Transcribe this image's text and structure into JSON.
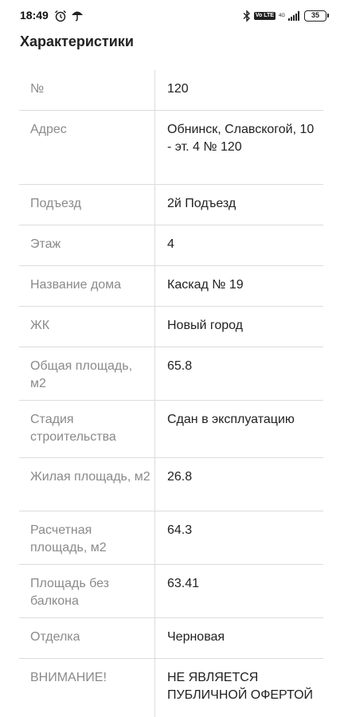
{
  "status_bar": {
    "time": "18:49",
    "icons": [
      "alarm-icon",
      "umbrella-icon",
      "bluetooth-icon",
      "volte-icon",
      "network-4g-icon",
      "signal-icon",
      "battery-icon"
    ],
    "volte": "Vo LTE",
    "network": "4G",
    "battery": "35"
  },
  "page_title": "Характеристики",
  "rows": [
    {
      "label": "№",
      "value": "120"
    },
    {
      "label": "Адрес",
      "value": "Обнинск, Славскогой, 10 - эт. 4 № 120"
    },
    {
      "label": "Подъезд",
      "value": "2й Подъезд"
    },
    {
      "label": "Этаж",
      "value": "4"
    },
    {
      "label": "Название дома",
      "value": "Каскад № 19"
    },
    {
      "label": "ЖК",
      "value": "Новый город"
    },
    {
      "label": "Общая площадь, м2",
      "value": "65.8"
    },
    {
      "label": "Стадия строительства",
      "value": "Сдан в эксплуатацию"
    },
    {
      "label": "Жилая площадь, м2",
      "value": "26.8"
    },
    {
      "label": "Расчетная площадь, м2",
      "value": "64.3"
    },
    {
      "label": "Площадь без балкона",
      "value": "63.41"
    },
    {
      "label": "Отделка",
      "value": "Черновая"
    },
    {
      "label": "ВНИМАНИЕ!",
      "value": "НЕ ЯВЛЯЕТСЯ ПУБЛИЧНОЙ ОФЕРТОЙ"
    }
  ]
}
